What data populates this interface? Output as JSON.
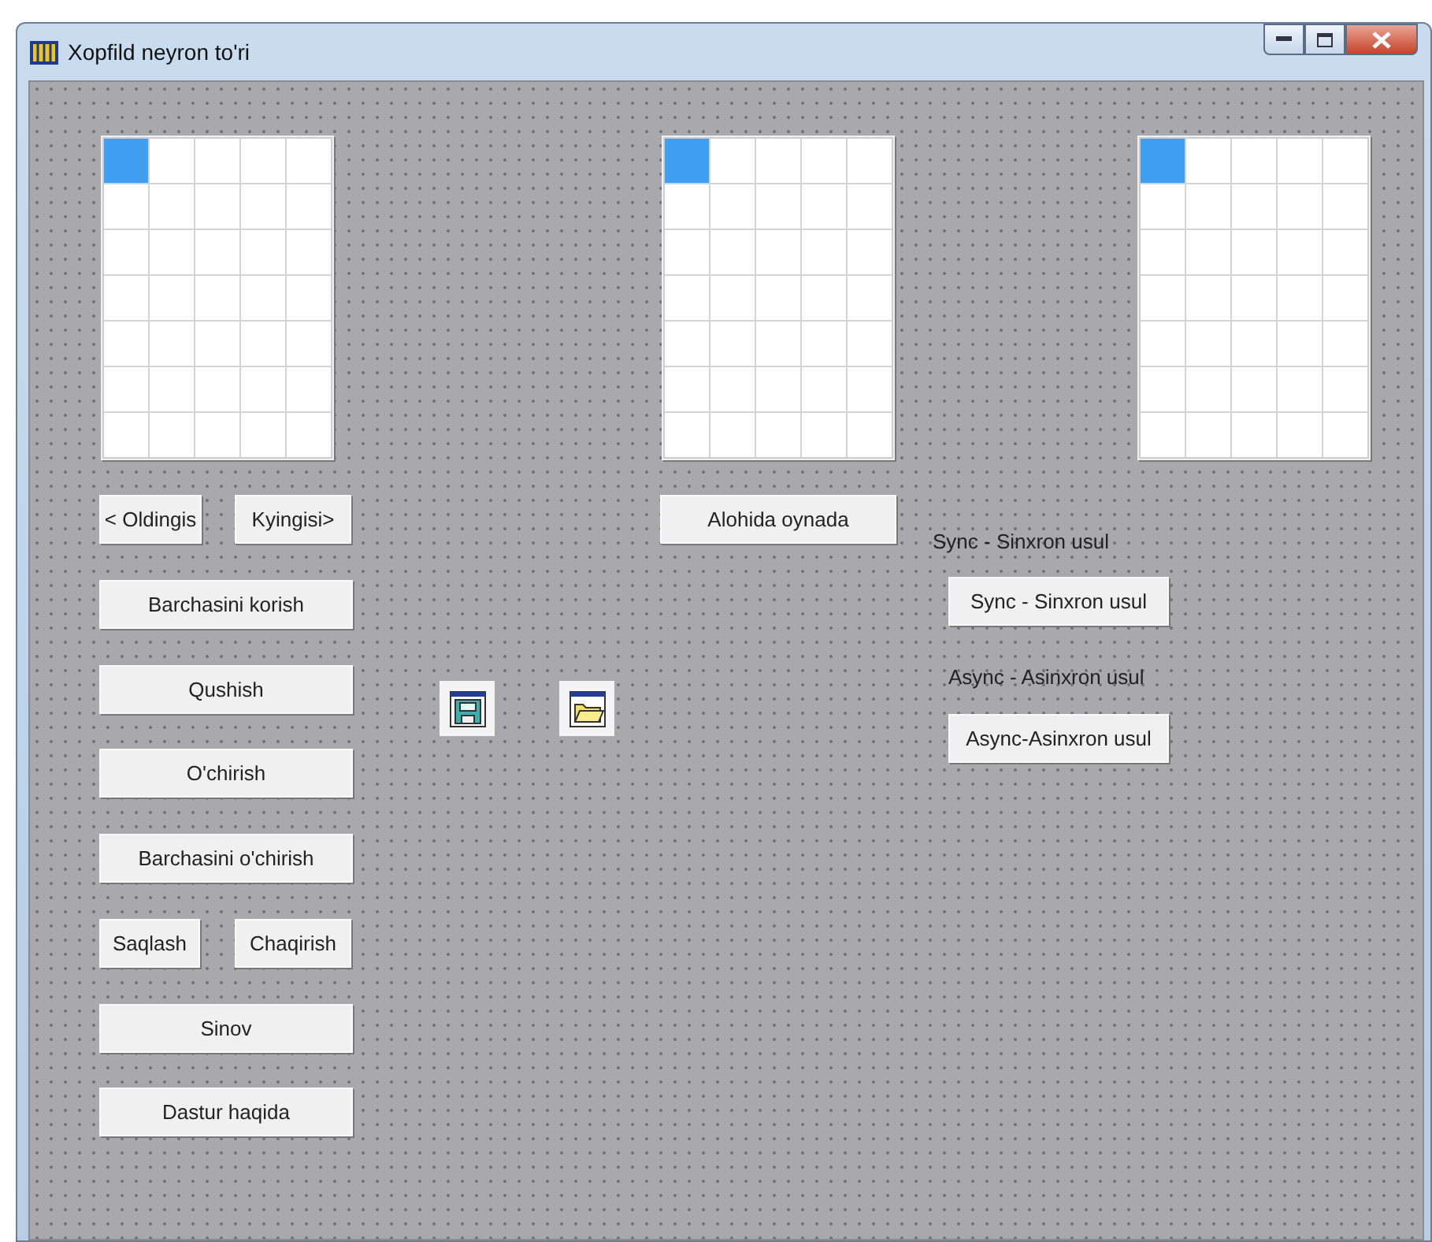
{
  "window": {
    "title": "Xopfild neyron to'ri"
  },
  "grids": [
    {
      "rows": [
        [
          true,
          false,
          false,
          false,
          false
        ],
        [
          false,
          false,
          false,
          false,
          false
        ],
        [
          false,
          false,
          false,
          false,
          false
        ],
        [
          false,
          false,
          false,
          false,
          false
        ],
        [
          false,
          false,
          false,
          false,
          false
        ],
        [
          false,
          false,
          false,
          false,
          false
        ],
        [
          false,
          false,
          false,
          false,
          false
        ]
      ]
    },
    {
      "rows": [
        [
          true,
          false,
          false,
          false,
          false
        ],
        [
          false,
          false,
          false,
          false,
          false
        ],
        [
          false,
          false,
          false,
          false,
          false
        ],
        [
          false,
          false,
          false,
          false,
          false
        ],
        [
          false,
          false,
          false,
          false,
          false
        ],
        [
          false,
          false,
          false,
          false,
          false
        ],
        [
          false,
          false,
          false,
          false,
          false
        ]
      ]
    },
    {
      "rows": [
        [
          true,
          false,
          false,
          false,
          false
        ],
        [
          false,
          false,
          false,
          false,
          false
        ],
        [
          false,
          false,
          false,
          false,
          false
        ],
        [
          false,
          false,
          false,
          false,
          false
        ],
        [
          false,
          false,
          false,
          false,
          false
        ],
        [
          false,
          false,
          false,
          false,
          false
        ],
        [
          false,
          false,
          false,
          false,
          false
        ]
      ]
    }
  ],
  "controls": [
    {
      "kind": "button",
      "text": "< Oldingis"
    },
    {
      "kind": "button",
      "text": "Kyingisi>"
    },
    {
      "kind": "button",
      "text": "Barchasini korish"
    },
    {
      "kind": "button",
      "text": "Qushish"
    },
    {
      "kind": "button",
      "text": "O'chirish"
    },
    {
      "kind": "button",
      "text": "Barchasini o'chirish"
    },
    {
      "kind": "button",
      "text": "Saqlash"
    },
    {
      "kind": "button",
      "text": "Chaqirish"
    },
    {
      "kind": "button",
      "text": "Sinov"
    },
    {
      "kind": "button",
      "text": "Dastur haqida"
    },
    {
      "kind": "button",
      "text": "Alohida oynada"
    },
    {
      "kind": "label",
      "text": "Sync - Sinxron usul"
    },
    {
      "kind": "button",
      "text": "Sync - Sinxron usul"
    },
    {
      "kind": "label",
      "text": "Async - Asinxron usul"
    },
    {
      "kind": "button",
      "text": "Async-Asinxron usul"
    },
    {
      "kind": "save-icon"
    },
    {
      "kind": "open-icon"
    }
  ]
}
